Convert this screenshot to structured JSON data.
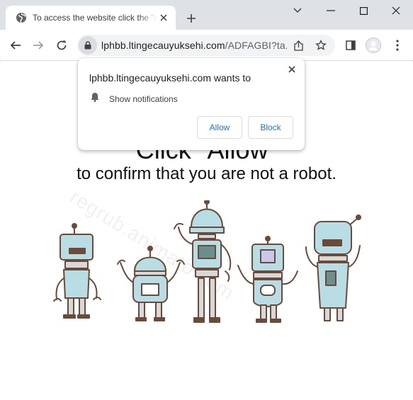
{
  "tab": {
    "title": "To access the website click the \"Allow\" button",
    "favicon": "globe-icon"
  },
  "window_controls": [
    "minimize-icon",
    "maximize-icon",
    "close-icon"
  ],
  "address_bar": {
    "host": "lphbb.ltingecauyuksehi.com",
    "path": "/ADFAGBI?ta..."
  },
  "permission_popup": {
    "title": "lphbb.ltingecauyuksehi.com wants to",
    "permission_label": "Show notifications",
    "allow_label": "Allow",
    "block_label": "Block"
  },
  "page": {
    "headline": "Click \"Allow\"",
    "subline": "to confirm that you are not a robot.",
    "watermark": "regrub.animato.com"
  },
  "colors": {
    "tabstrip": "#dee1e6",
    "accent": "#1a73e8",
    "robot_fill": "#b9dde4",
    "robot_stroke": "#6b4a3a"
  }
}
